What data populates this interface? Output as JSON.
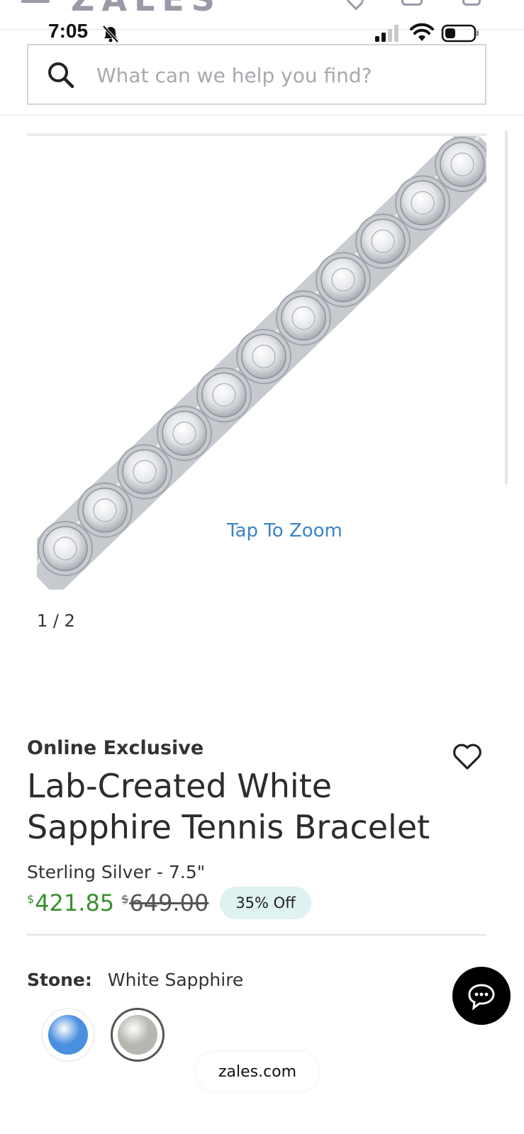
{
  "status_bar": {
    "time": "7:05"
  },
  "header": {
    "brand": "ZALES"
  },
  "search": {
    "placeholder": "What can we help you find?"
  },
  "gallery": {
    "zoom_label": "Tap To Zoom",
    "counter": "1 / 2"
  },
  "product": {
    "badge": "Online Exclusive",
    "title": "Lab-Created White Sapphire Tennis Bracelet",
    "variant": "Sterling Silver - 7.5\"",
    "price": {
      "currency": "$",
      "sale": "421.85",
      "original": "649.00",
      "discount": "35% Off"
    },
    "stone": {
      "label": "Stone:",
      "value": "White Sapphire"
    },
    "swatches": [
      {
        "color": "#4a8fe0"
      },
      {
        "color": "#b8b6b0"
      }
    ]
  },
  "browser": {
    "url": "zales.com"
  },
  "colors": {
    "accent_price": "#3a8f2e",
    "zoom_link": "#3d83c7",
    "discount_bg": "#dff1f0"
  }
}
